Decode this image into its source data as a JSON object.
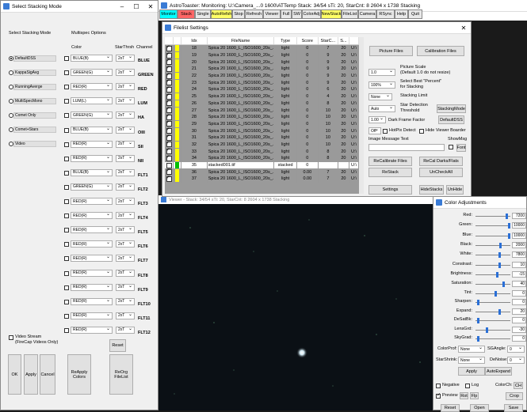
{
  "colors": {
    "monitor": "#00ffff",
    "stack": "#ff6666",
    "autorefresh": "#ffff66",
    "newstack": "#ffff66",
    "green_swatch": "#00c000",
    "yellow_swatch": "#ffff00",
    "slider": "#2a6fd6"
  },
  "stacking": {
    "title": "Select Stacking Mode",
    "mode_heading": "Select Stacking Mode",
    "multispec_heading": "Multispec Options",
    "col_color": "Color",
    "col_thresh": "StarThrsh",
    "col_channel": "Channel",
    "modes": [
      "DefaultDSS",
      "KappaSigAvg",
      "RunningAverge",
      "MultiSpecMono",
      "Comet Only",
      "Comet+Stars",
      "Video"
    ],
    "rows": [
      {
        "color": "BLUE(B)",
        "thr": "2xT",
        "ch": "BLUE"
      },
      {
        "color": "GREEN(G)",
        "thr": "2xT",
        "ch": "GREEN"
      },
      {
        "color": "RED(R)",
        "thr": "2xT",
        "ch": "RED"
      },
      {
        "color": "LUM(L)",
        "thr": "2xT",
        "ch": "LUM"
      },
      {
        "color": "GREEN(G)",
        "thr": "2xT",
        "ch": "HA"
      },
      {
        "color": "BLUE(B)",
        "thr": "2xT",
        "ch": "OIII"
      },
      {
        "color": "RED(R)",
        "thr": "2xT",
        "ch": "SII"
      },
      {
        "color": "RED(R)",
        "thr": "2xT",
        "ch": "NII"
      },
      {
        "color": "BLUE(B)",
        "thr": "2xT",
        "ch": "FLT1"
      },
      {
        "color": "GREEN(G)",
        "thr": "2xT",
        "ch": "FLT2"
      },
      {
        "color": "RED(R)",
        "thr": "2xT",
        "ch": "FLT3"
      },
      {
        "color": "RED(R)",
        "thr": "2xT",
        "ch": "FLT4"
      },
      {
        "color": "RED(R)",
        "thr": "2xT",
        "ch": "FLT5"
      },
      {
        "color": "RED(R)",
        "thr": "2xT",
        "ch": "FLT6"
      },
      {
        "color": "RED(R)",
        "thr": "2xT",
        "ch": "FLT7"
      },
      {
        "color": "RED(R)",
        "thr": "2xT",
        "ch": "FLT8"
      },
      {
        "color": "RED(R)",
        "thr": "2xT",
        "ch": "FLT9"
      },
      {
        "color": "RED(R)",
        "thr": "2xT",
        "ch": "FLT10"
      },
      {
        "color": "RED(R)",
        "thr": "2xT",
        "ch": "FLT11"
      },
      {
        "color": "RED(R)",
        "thr": "2xT",
        "ch": "FLT12"
      }
    ],
    "video_stream": "Video Stream\n(FireCap Videos Only)",
    "ok": "OK",
    "apply": "Apply",
    "cancel": "Cancel",
    "reapply": "ReApply Colors",
    "reset": "Reset",
    "reorg": "ReOrg FileList"
  },
  "main": {
    "title": "AstroToaster: Monitoring: U:\\Camera_...0 1600\\ATTemp   Stack: 34/54   sTi: 20, StarCnt: 8   2604 x 1738    Stacking",
    "toolbar": [
      "Monitor",
      "Stack",
      "Single",
      "AutoRefsh",
      "Stop",
      "Refresh",
      "Viewer",
      "Full",
      "SW",
      "ColorAdj",
      "NewStack",
      "FileList",
      "Camera",
      "RSync",
      "Help",
      "Quit"
    ]
  },
  "filelist": {
    "title": "Filelist Settings",
    "headers": [
      "Idx",
      "FileName",
      "Type",
      "Score",
      "StarC...",
      "S..."
    ],
    "rows": [
      {
        "idx": "18",
        "name": "Spica 20 1600_L_ISO1600_20s_...",
        "type": "light",
        "score": "0",
        "star": "7",
        "s": "20",
        "t": "U:\\",
        "sw": "y",
        "on": true
      },
      {
        "idx": "19",
        "name": "Spica 20 1600_L_ISO1600_20s_...",
        "type": "light",
        "score": "0",
        "star": "9",
        "s": "20",
        "t": "U:\\",
        "sw": "y",
        "on": true
      },
      {
        "idx": "20",
        "name": "Spica 20 1600_L_ISO1600_20s_...",
        "type": "light",
        "score": "0",
        "star": "9",
        "s": "20",
        "t": "U:\\",
        "sw": "y",
        "on": true
      },
      {
        "idx": "21",
        "name": "Spica 20 1600_L_ISO1600_20s_...",
        "type": "light",
        "score": "0",
        "star": "9",
        "s": "20",
        "t": "U:\\",
        "sw": "y",
        "on": true
      },
      {
        "idx": "22",
        "name": "Spica 20 1600_L_ISO1600_20s_...",
        "type": "light",
        "score": "0",
        "star": "9",
        "s": "20",
        "t": "U:\\",
        "sw": "y",
        "on": true
      },
      {
        "idx": "23",
        "name": "Spica 20 1600_L_ISO1600_20s_...",
        "type": "light",
        "score": "0",
        "star": "9",
        "s": "20",
        "t": "U:\\",
        "sw": "y",
        "on": true
      },
      {
        "idx": "24",
        "name": "Spica 20 1600_L_ISO1600_20s_...",
        "type": "light",
        "score": "0",
        "star": "6",
        "s": "20",
        "t": "U:\\",
        "sw": "y",
        "on": true
      },
      {
        "idx": "25",
        "name": "Spica 20 1600_L_ISO1600_20s_...",
        "type": "light",
        "score": "0",
        "star": "4",
        "s": "20",
        "t": "U:\\",
        "sw": "y",
        "on": true
      },
      {
        "idx": "26",
        "name": "Spica 20 1600_L_ISO1600_20s_...",
        "type": "light",
        "score": "0",
        "star": "8",
        "s": "20",
        "t": "U:\\",
        "sw": "y",
        "on": true
      },
      {
        "idx": "27",
        "name": "Spica 20 1600_L_ISO1600_20s_...",
        "type": "light",
        "score": "0",
        "star": "10",
        "s": "20",
        "t": "U:\\",
        "sw": "y",
        "on": true
      },
      {
        "idx": "28",
        "name": "Spica 20 1600_L_ISO1600_20s_...",
        "type": "light",
        "score": "0",
        "star": "10",
        "s": "20",
        "t": "U:\\",
        "sw": "y",
        "on": true
      },
      {
        "idx": "29",
        "name": "Spica 20 1600_L_ISO1600_20s_...",
        "type": "light",
        "score": "0",
        "star": "10",
        "s": "20",
        "t": "U:\\",
        "sw": "y",
        "on": true
      },
      {
        "idx": "30",
        "name": "Spica 20 1600_L_ISO1600_20s_...",
        "type": "light",
        "score": "0",
        "star": "10",
        "s": "20",
        "t": "U:\\",
        "sw": "y",
        "on": true
      },
      {
        "idx": "31",
        "name": "Spica 20 1600_L_ISO1600_20s_...",
        "type": "light",
        "score": "0",
        "star": "10",
        "s": "20",
        "t": "U:\\",
        "sw": "y",
        "on": true
      },
      {
        "idx": "32",
        "name": "Spica 20 1600_L_ISO1600_20s_...",
        "type": "light",
        "score": "0",
        "star": "10",
        "s": "20",
        "t": "U:\\",
        "sw": "y",
        "on": true
      },
      {
        "idx": "33",
        "name": "Spica 20 1600_L_ISO1600_20s_...",
        "type": "light",
        "score": "0",
        "star": "8",
        "s": "20",
        "t": "U:\\",
        "sw": "y",
        "on": true
      },
      {
        "idx": "34",
        "name": "Spica 20 1600_L_ISO1600_20s_...",
        "type": "light",
        "score": "0",
        "star": "8",
        "s": "20",
        "t": "U:\\",
        "sw": "y",
        "on": true
      },
      {
        "idx": "35",
        "name": "stacked001.tif",
        "type": "stacked",
        "score": "0",
        "star": "",
        "s": "",
        "t": "U:\\",
        "sw": "g",
        "on": false,
        "hl": true
      },
      {
        "idx": "36",
        "name": "Spica 20 1600_L_ISO1600_20s_...",
        "type": "light",
        "score": "0.00",
        "star": "7",
        "s": "20",
        "t": "U:\\",
        "sw": "y",
        "on": true
      },
      {
        "idx": "37",
        "name": "Spica 20 1600_L_ISO1600_20s_...",
        "type": "light",
        "score": "0.00",
        "star": "7",
        "s": "20",
        "t": "U:\\",
        "sw": "y",
        "on": true
      }
    ],
    "picture_files": "Picture Files",
    "calibration_files": "Calibration Files",
    "pic_scale_val": "1.0",
    "pic_scale_lbl": "Picture Scale\n(Default 1.0 do not resize)",
    "best_pct_val": "100%",
    "best_pct_lbl": "Select Best \"Percent\"\nfor Stacking",
    "stack_limit_val": "None",
    "stack_limit_lbl": "Stacking Limit",
    "star_det_val": "Auto",
    "star_det_lbl": "Star Detection\nThreshold",
    "stacking_mode_btn": "StackingMode",
    "dark_val": "1.00",
    "dark_lbl": "Dark Frame Factor",
    "default_dss": "DefaultDSS",
    "hotpix_val": "Off",
    "hotpix_lbl": "HotPix Detect",
    "hide_viewer": "Hide Viewer Boarder",
    "img_msg": "Image Message Text",
    "showmsg": "ShowMsg",
    "font": "Font",
    "recal_files": "ReCalibrate Files",
    "recal_darks": "ReCal Darks/Flats",
    "restack": "ReStack",
    "uncheck_all": "UnCheckAll",
    "settings": "Settings",
    "hide_stacks": "HideStacks",
    "unhide": "UnHide"
  },
  "viewer": {
    "title": "Viewer - Stack: 34/54   sTi: 20, StarCnt: 8   2604 x 1738     Stacking"
  },
  "color": {
    "title": "Color Adjustments",
    "sliders": [
      {
        "label": "Red:",
        "value": "7200",
        "pos": 0.9
      },
      {
        "label": "Green:",
        "value": "10000",
        "pos": 0.98
      },
      {
        "label": "Blue:",
        "value": "10000",
        "pos": 0.98
      },
      {
        "label": "Black:",
        "value": "2000",
        "pos": 0.72
      },
      {
        "label": "White:",
        "value": "7800",
        "pos": 0.68
      },
      {
        "label": "Constrast:",
        "value": "10",
        "pos": 0.68
      },
      {
        "label": "Brightness:",
        "value": "-15",
        "pos": 0.62
      },
      {
        "label": "Saturation:",
        "value": "40",
        "pos": 0.82
      },
      {
        "label": "Tint:",
        "value": "0",
        "pos": 0.58
      }
    ],
    "sliders2": [
      {
        "label": "Sharpen:",
        "value": "0",
        "pos": 0.05
      },
      {
        "label": "Expand:",
        "value": "20",
        "pos": 0.68
      },
      {
        "label": "DeSatBk:",
        "value": "0",
        "pos": 0.05
      },
      {
        "label": "LensGrd:",
        "value": "-30",
        "pos": 0.32
      },
      {
        "label": "SkyGrad:",
        "value": "0",
        "pos": 0.05
      }
    ],
    "colorprof": "ColorProf:",
    "colorprof_val": "None",
    "sgangle": "SGAngle:",
    "sgangle_val": "0",
    "starshrink": "StarShrink:",
    "starshrink_val": "None",
    "denoise": "DeNoise:",
    "denoise_val": "0",
    "apply": "Apply",
    "autoexpand": "AutoExpand",
    "negative": "Negative",
    "log": "Log",
    "colorch": "ColorCh:",
    "colorch_val": "CH",
    "preview": "Preview",
    "rot": "Rot",
    "flp": "Flp",
    "crop": "Crop",
    "reset": "Reset",
    "open": "Open",
    "save": "Save"
  }
}
